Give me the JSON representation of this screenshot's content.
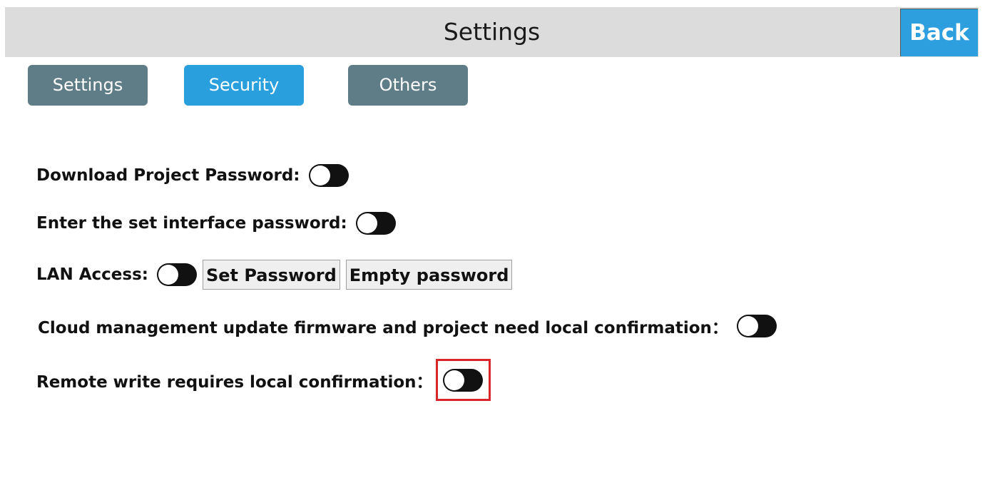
{
  "header": {
    "title": "Settings",
    "back_label": "Back"
  },
  "tabs": [
    {
      "label": "Settings",
      "active": false
    },
    {
      "label": "Security",
      "active": true
    },
    {
      "label": "Others",
      "active": false
    }
  ],
  "security": {
    "download_project_password": {
      "label": "Download Project Password:",
      "enabled": false
    },
    "enter_set_interface_password": {
      "label": "Enter the set interface password:",
      "enabled": false
    },
    "lan_access": {
      "label": "LAN Access:",
      "enabled": false,
      "set_password_label": "Set Password",
      "empty_password_label": "Empty password"
    },
    "cloud_management_confirmation": {
      "label": "Cloud management update firmware and project need local confirmation：",
      "enabled": false
    },
    "remote_write_confirmation": {
      "label": "Remote write requires local confirmation：",
      "enabled": false
    }
  },
  "colors": {
    "header_bg": "#dcdcdc",
    "accent": "#2a9fdd",
    "tab_inactive": "#5f7d86",
    "highlight": "#d8262b"
  }
}
